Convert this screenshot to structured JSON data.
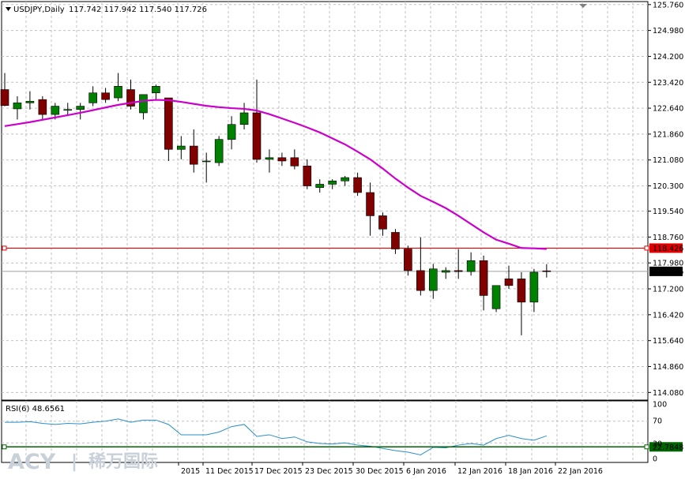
{
  "header": {
    "symbol_label": "USDJPY,Daily",
    "ohlc_text": "117.742 117.942 117.540 117.726"
  },
  "price_panel": {
    "y_ticks": [
      "125.760",
      "124.980",
      "124.200",
      "123.420",
      "122.640",
      "121.860",
      "121.080",
      "120.300",
      "119.540",
      "118.760",
      "117.980",
      "117.200",
      "116.420",
      "115.640",
      "114.860",
      "114.080"
    ],
    "level_line": {
      "value": 118.426,
      "label": "118.426",
      "color": "#e00000"
    },
    "current_price": {
      "value": 117.726,
      "label": "117.726"
    },
    "bull_color": "#008000",
    "bear_color": "#800000",
    "ma_color": "#cc00cc"
  },
  "rsi_panel": {
    "label": "RSI(6) 48.6561",
    "y_ticks": [
      "100",
      "70",
      "30",
      "0"
    ],
    "level_label": "22.7848",
    "level_value": 22.7848,
    "line_color": "#2a8fc8",
    "level_color": "#006400"
  },
  "x_labels": [
    "2015",
    "11 Dec 2015",
    "17 Dec 2015",
    "23 Dec 2015",
    "30 Dec 2015",
    "6 Jan 2016",
    "12 Jan 2016",
    "18 Jan 2016",
    "22 Jan 2016"
  ],
  "watermark": {
    "brand": "ACY",
    "separator": "|",
    "chinese": "稀万国际"
  },
  "chart_data": {
    "type": "candlestick",
    "title": "USDJPY,Daily",
    "y_range": [
      113.85,
      125.85
    ],
    "candles": [
      {
        "o": 123.2,
        "h": 123.7,
        "l": 122.7,
        "c": 122.72
      },
      {
        "o": 122.62,
        "h": 123.0,
        "l": 122.3,
        "c": 122.8
      },
      {
        "o": 122.8,
        "h": 123.15,
        "l": 122.6,
        "c": 122.85
      },
      {
        "o": 122.9,
        "h": 123.0,
        "l": 122.3,
        "c": 122.45
      },
      {
        "o": 122.45,
        "h": 122.8,
        "l": 122.3,
        "c": 122.7
      },
      {
        "o": 122.6,
        "h": 122.8,
        "l": 122.4,
        "c": 122.6
      },
      {
        "o": 122.6,
        "h": 122.8,
        "l": 122.3,
        "c": 122.7
      },
      {
        "o": 122.8,
        "h": 123.3,
        "l": 122.7,
        "c": 123.1
      },
      {
        "o": 123.1,
        "h": 123.25,
        "l": 122.8,
        "c": 122.9
      },
      {
        "o": 122.95,
        "h": 123.7,
        "l": 122.85,
        "c": 123.3
      },
      {
        "o": 123.2,
        "h": 123.5,
        "l": 122.6,
        "c": 122.7
      },
      {
        "o": 122.5,
        "h": 123.0,
        "l": 122.3,
        "c": 123.05
      },
      {
        "o": 123.1,
        "h": 123.35,
        "l": 122.9,
        "c": 123.3
      },
      {
        "o": 122.95,
        "h": 122.95,
        "l": 121.05,
        "c": 121.4
      },
      {
        "o": 121.4,
        "h": 121.8,
        "l": 121.1,
        "c": 121.5
      },
      {
        "o": 121.5,
        "h": 122.0,
        "l": 120.7,
        "c": 120.95
      },
      {
        "o": 121.05,
        "h": 121.3,
        "l": 120.4,
        "c": 121.05
      },
      {
        "o": 121.0,
        "h": 121.8,
        "l": 120.9,
        "c": 121.7
      },
      {
        "o": 121.7,
        "h": 122.4,
        "l": 121.4,
        "c": 122.15
      },
      {
        "o": 122.15,
        "h": 122.8,
        "l": 122.0,
        "c": 122.5
      },
      {
        "o": 122.5,
        "h": 123.5,
        "l": 121.0,
        "c": 121.1
      },
      {
        "o": 121.1,
        "h": 121.4,
        "l": 120.7,
        "c": 121.15
      },
      {
        "o": 121.15,
        "h": 121.3,
        "l": 120.9,
        "c": 121.05
      },
      {
        "o": 121.15,
        "h": 121.4,
        "l": 120.8,
        "c": 120.9
      },
      {
        "o": 120.9,
        "h": 121.1,
        "l": 120.2,
        "c": 120.3
      },
      {
        "o": 120.25,
        "h": 120.5,
        "l": 120.1,
        "c": 120.35
      },
      {
        "o": 120.35,
        "h": 120.5,
        "l": 120.2,
        "c": 120.45
      },
      {
        "o": 120.45,
        "h": 120.6,
        "l": 120.3,
        "c": 120.55
      },
      {
        "o": 120.55,
        "h": 120.7,
        "l": 120.0,
        "c": 120.1
      },
      {
        "o": 120.1,
        "h": 120.4,
        "l": 118.8,
        "c": 119.4
      },
      {
        "o": 119.4,
        "h": 119.5,
        "l": 118.8,
        "c": 119.0
      },
      {
        "o": 118.9,
        "h": 119.0,
        "l": 118.25,
        "c": 118.4
      },
      {
        "o": 118.4,
        "h": 118.5,
        "l": 117.6,
        "c": 117.75
      },
      {
        "o": 117.75,
        "h": 118.75,
        "l": 117.0,
        "c": 117.15
      },
      {
        "o": 117.15,
        "h": 117.95,
        "l": 116.9,
        "c": 117.8
      },
      {
        "o": 117.7,
        "h": 117.85,
        "l": 117.5,
        "c": 117.75
      },
      {
        "o": 117.75,
        "h": 118.4,
        "l": 117.5,
        "c": 117.72
      },
      {
        "o": 117.72,
        "h": 118.3,
        "l": 117.6,
        "c": 118.05
      },
      {
        "o": 118.05,
        "h": 118.2,
        "l": 116.55,
        "c": 117.0
      },
      {
        "o": 116.6,
        "h": 117.3,
        "l": 116.5,
        "c": 117.3
      },
      {
        "o": 117.5,
        "h": 117.9,
        "l": 117.2,
        "c": 117.3
      },
      {
        "o": 117.5,
        "h": 117.7,
        "l": 115.8,
        "c": 116.8
      },
      {
        "o": 116.8,
        "h": 117.8,
        "l": 116.5,
        "c": 117.7
      },
      {
        "o": 117.742,
        "h": 117.942,
        "l": 117.54,
        "c": 117.726
      }
    ],
    "moving_average": [
      122.1,
      122.16,
      122.22,
      122.29,
      122.36,
      122.43,
      122.5,
      122.58,
      122.66,
      122.74,
      122.8,
      122.86,
      122.89,
      122.88,
      122.83,
      122.77,
      122.71,
      122.67,
      122.64,
      122.62,
      122.57,
      122.46,
      122.33,
      122.2,
      122.06,
      121.91,
      121.73,
      121.55,
      121.33,
      121.1,
      120.82,
      120.52,
      120.25,
      120.0,
      119.82,
      119.63,
      119.4,
      119.15,
      118.9,
      118.68,
      118.56,
      118.43,
      118.42,
      118.4
    ],
    "rsi": [
      68,
      68,
      69,
      66,
      64,
      66,
      65,
      68,
      70,
      74,
      68,
      72,
      72,
      64,
      45,
      45,
      45,
      50,
      60,
      64,
      42,
      45,
      38,
      41,
      32,
      29,
      28,
      30,
      26,
      24,
      20,
      16,
      13,
      8,
      22,
      21,
      26,
      29,
      26,
      38,
      44,
      38,
      35,
      43
    ]
  }
}
